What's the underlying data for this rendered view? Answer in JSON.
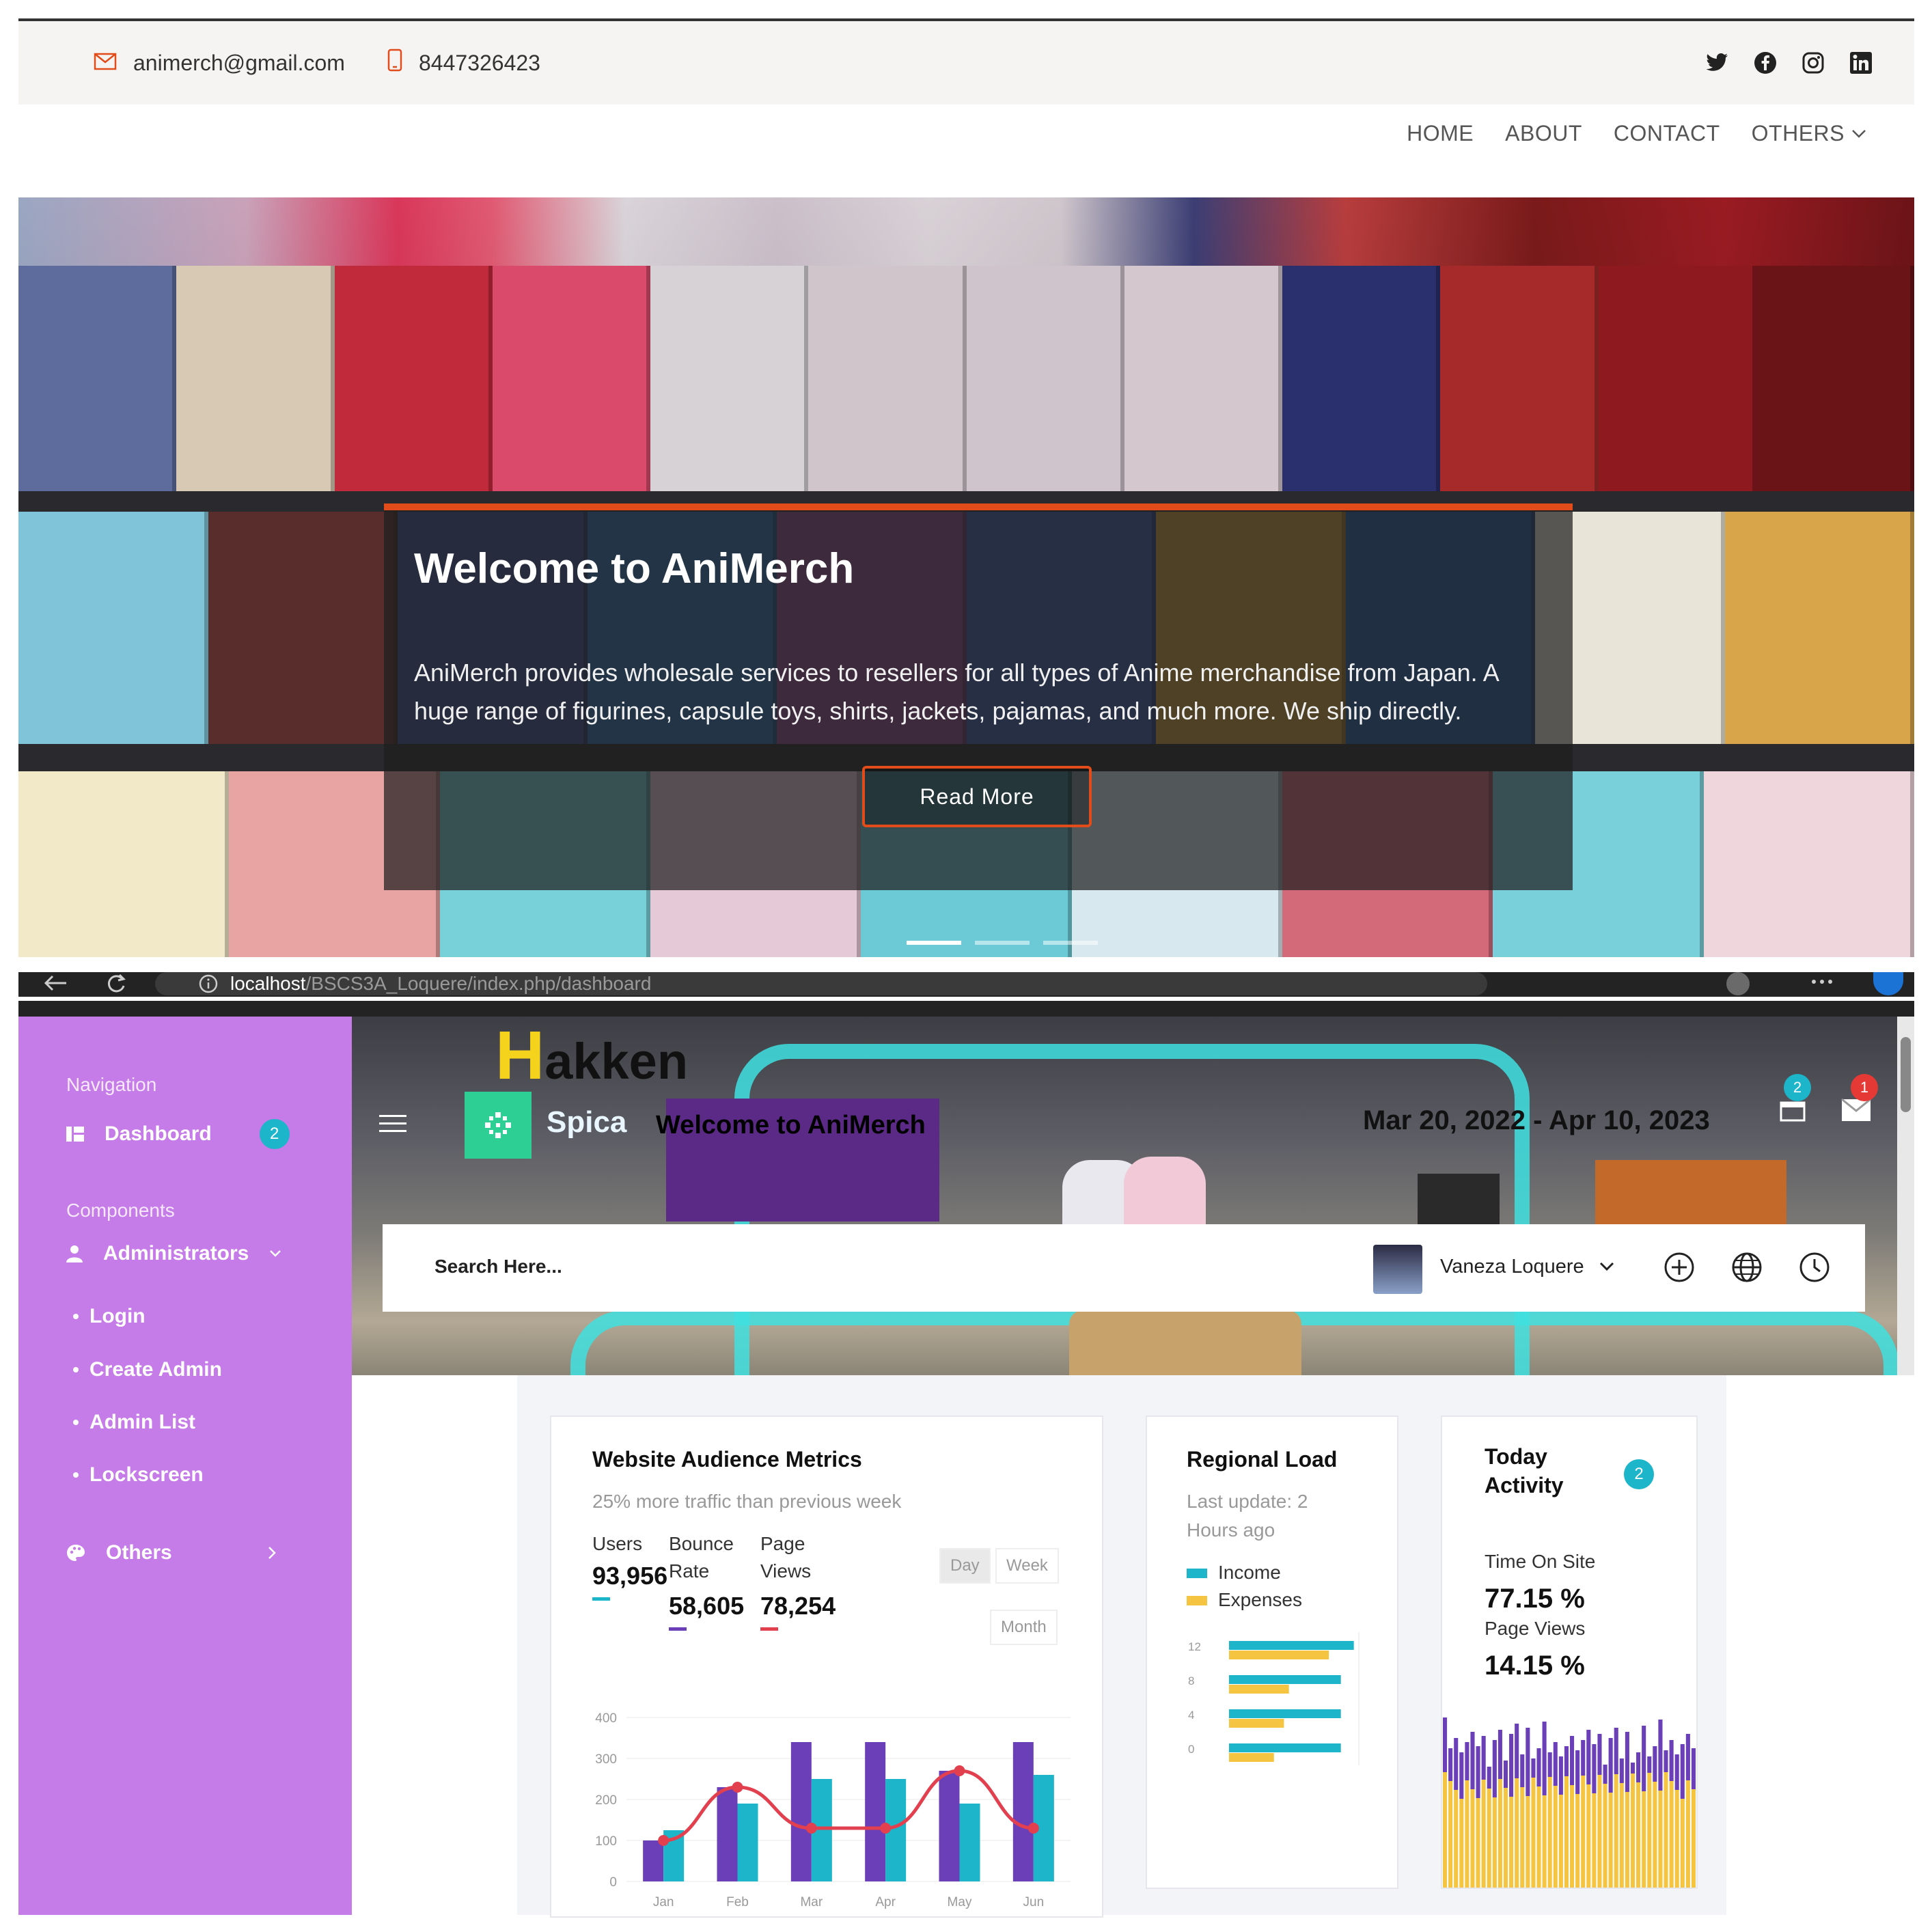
{
  "site": {
    "email": "animerch@gmail.com",
    "phone": "8447326423",
    "social": [
      "twitter-icon",
      "facebook-icon",
      "instagram-icon",
      "linkedin-icon"
    ],
    "nav": [
      "HOME",
      "ABOUT",
      "CONTACT",
      "OTHERS"
    ],
    "hero": {
      "title": "Welcome to AniMerch",
      "text": "AniMerch provides wholesale services to resellers for all types of Anime merchandise from Japan. A huge range of figurines, capsule toys, shirts, jackets, pajamas, and much more. We ship directly.",
      "button": "Read More"
    },
    "accent": "#e24c1a"
  },
  "browser": {
    "url_host": "localhost",
    "url_path": "/BSCS3A_Loquere/index.php/dashboard"
  },
  "sidebar": {
    "nav_heading": "Navigation",
    "dashboard": "Dashboard",
    "dashboard_badge": "2",
    "components_heading": "Components",
    "administrators": "Administrators",
    "sub_items": [
      "Login",
      "Create Admin",
      "Admin List",
      "Lockscreen"
    ],
    "others": "Others",
    "color": "#c57be8"
  },
  "header": {
    "brand_sign": "akken",
    "brand_sign_h": "H",
    "logo_text": "Spica",
    "welcome": "Welcome to AniMerch",
    "date_range": "Mar 20, 2022 - Apr 10, 2023",
    "badge_calendar": "2",
    "badge_mail": "1",
    "search_placeholder": "Search Here...",
    "user_name": "Vaneza Loquere"
  },
  "metrics": {
    "title": "Website Audience Metrics",
    "subtitle": "25% more traffic than previous week",
    "users_label": "Users",
    "users_value": "93,956",
    "bounce_label_1": "Bounce",
    "bounce_label_2": "Rate",
    "bounce_value": "58,605",
    "pageviews_label_1": "Page",
    "pageviews_label_2": "Views",
    "pageviews_value": "78,254",
    "btn_day": "Day",
    "btn_week": "Week",
    "btn_month": "Month"
  },
  "regional": {
    "title": "Regional Load",
    "update_1": "Last update: 2",
    "update_2": "Hours ago",
    "legend_income": "Income",
    "legend_expenses": "Expenses"
  },
  "today": {
    "title_1": "Today",
    "title_2": "Activity",
    "badge": "2",
    "time_label": "Time On Site",
    "time_value": "77.15 %",
    "pv_label": "Page Views",
    "pv_value": "14.15 %"
  },
  "chart_data": [
    {
      "type": "bar",
      "categories": [
        "Jan",
        "Feb",
        "Mar",
        "Apr",
        "May",
        "Jun"
      ],
      "ylim": [
        0,
        400
      ],
      "yticks": [
        0,
        100,
        200,
        300,
        400
      ],
      "series": [
        {
          "color": "#6a3fb8",
          "values": [
            100,
            230,
            340,
            340,
            270,
            340
          ]
        },
        {
          "color": "#1cb5c9",
          "values": [
            125,
            190,
            250,
            250,
            190,
            260
          ]
        }
      ],
      "line": {
        "color": "#e2404f",
        "values": [
          100,
          230,
          130,
          130,
          270,
          130
        ]
      }
    },
    {
      "type": "bar",
      "orientation": "horizontal",
      "categories": [
        "12",
        "8",
        "4",
        "0"
      ],
      "series": [
        {
          "name": "Income",
          "color": "#1cb5c9",
          "values": [
            12.5,
            11.2,
            11.2,
            11.2
          ]
        },
        {
          "name": "Expenses",
          "color": "#f5c542",
          "values": [
            10,
            6,
            5.5,
            4.5
          ]
        }
      ]
    }
  ]
}
